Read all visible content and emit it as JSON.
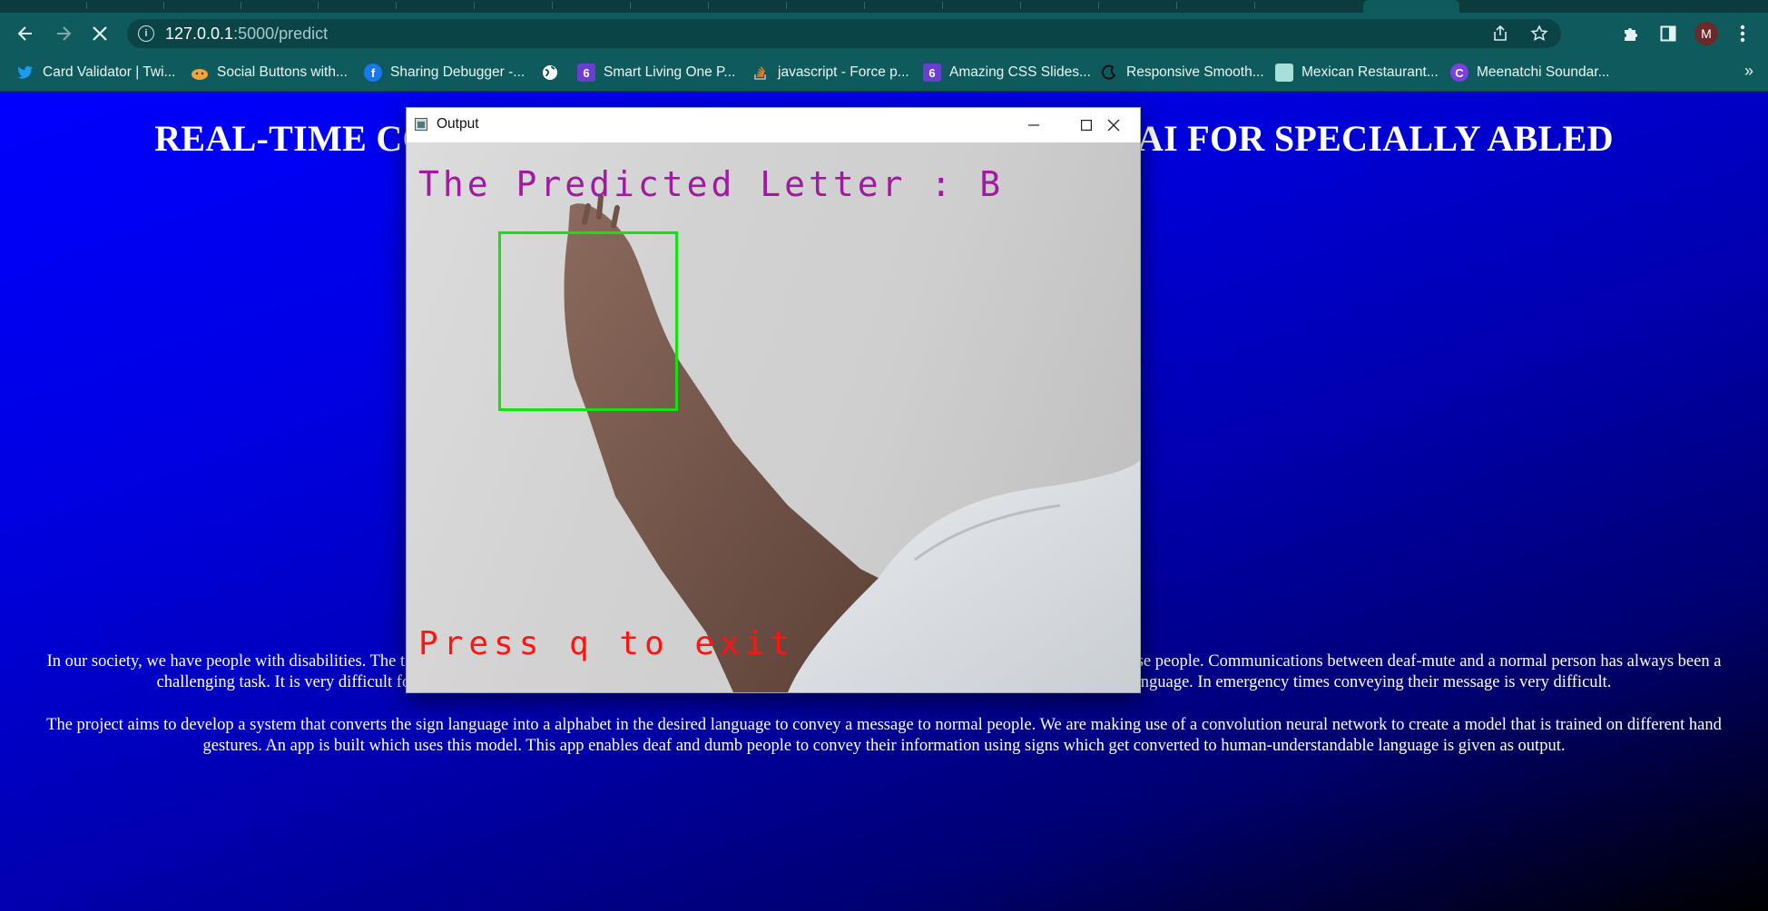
{
  "browser": {
    "url_host": "127.0.0.1",
    "url_path": ":5000/predict",
    "avatar_letter": "M",
    "bookmarks": [
      {
        "label": "Card Validator | Twi...",
        "icon": "twitter-icon",
        "color": "#1d9bf0"
      },
      {
        "label": "Social Buttons with...",
        "icon": "emoji-face-icon",
        "color": "#f2a33a"
      },
      {
        "label": "Sharing Debugger -...",
        "icon": "facebook-icon",
        "color": "#1877f2"
      },
      {
        "label": "",
        "icon": "globe-icon",
        "color": "#ffffff"
      },
      {
        "label": "Smart Living One P...",
        "icon": "six-logo-icon",
        "color": "#6a3fd0"
      },
      {
        "label": "javascript - Force p...",
        "icon": "stackoverflow-icon",
        "color": "#f48024"
      },
      {
        "label": "Amazing CSS Slides...",
        "icon": "six-logo-icon",
        "color": "#6a3fd0"
      },
      {
        "label": "Responsive Smooth...",
        "icon": "moon-logo-icon",
        "color": "#111111"
      },
      {
        "label": "Mexican Restaurant...",
        "icon": "image-icon",
        "color": "#a7e0d8"
      },
      {
        "label": "Meenatchi Soundar...",
        "icon": "canva-icon",
        "color": "#7b3fe4"
      }
    ]
  },
  "page": {
    "title": "REAL-TIME COMMUNICATION SYSTEM POWERED BY AI FOR SPECIALLY ABLED",
    "paragraph1": "In our society, we have people with disabilities. The technology is developing day by day but no significant developments are undertaken for the betterment of these people. Communications between deaf-mute and a normal person has always been a challenging task. It is very difficult for mute people to convey their message to normal people. Since normal people are not trained on hand sign language. In emergency times conveying their message is very difficult.",
    "paragraph2": "The project aims to develop a system that converts the sign language into a alphabet in the desired language to convey a message to normal people. We are making use of a convolution neural network to create a model that is trained on different hand gestures. An app is built which uses this model. This app enables deaf and dumb people to convey their information using signs which get converted to human-understandable language is given as output."
  },
  "output_window": {
    "title": "Output",
    "prediction_text": "The Predicted Letter : B",
    "exit_text": "Press q to exit",
    "roi_color": "#14e014"
  }
}
